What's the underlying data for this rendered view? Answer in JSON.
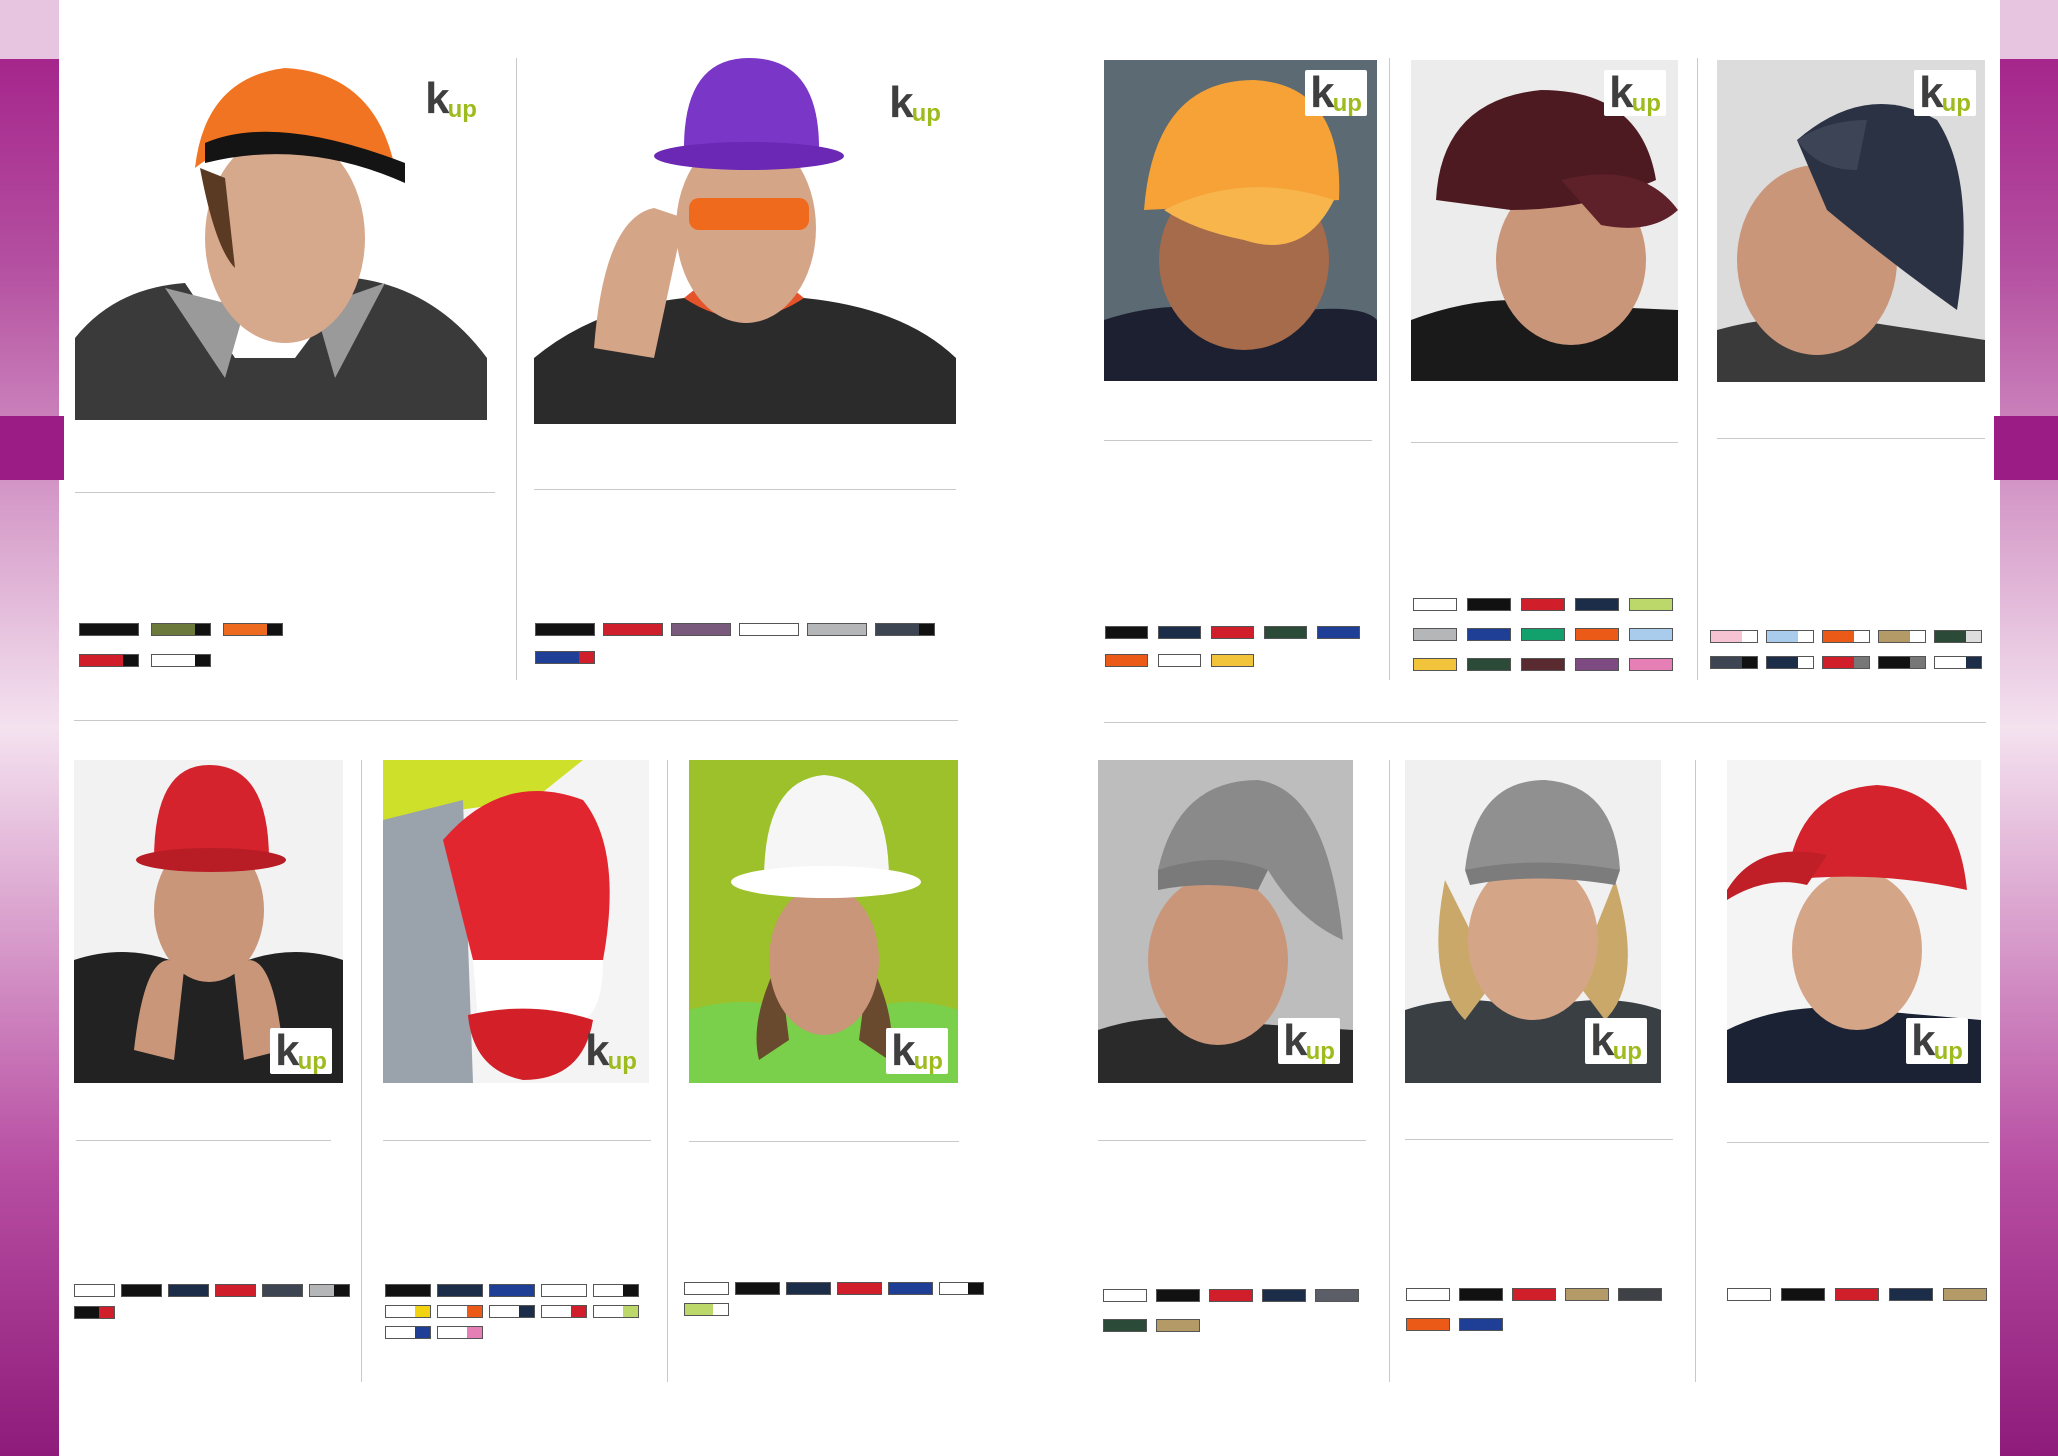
{
  "brand": {
    "logo_k": "k",
    "logo_up": "up",
    "logo_color": "#9dbb1c"
  },
  "theme": {
    "accent": "#a11a86",
    "rule": "#c9c9c9"
  },
  "products": [
    {
      "id": "p1",
      "logo": "plain",
      "swatches": [
        [
          "#111111"
        ],
        [
          "#6b7a3b",
          "#111111"
        ],
        [
          "#ee6a1e",
          "#111111"
        ],
        [
          "#d01e2a",
          "#111111"
        ],
        [
          "#ffffff",
          "#111111"
        ]
      ]
    },
    {
      "id": "p2",
      "logo": "plain",
      "swatches": [
        [
          "#111111"
        ],
        [
          "#cf1f2c"
        ],
        [
          "#7a5a7c"
        ],
        [
          "#ffffff"
        ],
        [
          "#b5b6b8"
        ],
        [
          "#3e4552",
          "#111111"
        ],
        [
          "#1f3f97",
          "#d01e2a"
        ]
      ]
    },
    {
      "id": "p3",
      "logo": "boxed",
      "swatches": [
        [
          "#111111"
        ],
        [
          "#1c2d4a"
        ],
        [
          "#d01e2a"
        ],
        [
          "#2c4a38"
        ],
        [
          "#1f3f97"
        ],
        [
          "#ec5a17"
        ],
        [
          "#ffffff"
        ],
        [
          "#f2c43b"
        ]
      ]
    },
    {
      "id": "p4",
      "logo": "boxed",
      "swatches": [
        [
          "#ffffff"
        ],
        [
          "#111111"
        ],
        [
          "#d01e2a"
        ],
        [
          "#1c2d4a"
        ],
        [
          "#bcd86a"
        ],
        [
          "#b5b6b8"
        ],
        [
          "#1f3f97"
        ],
        [
          "#12a06d"
        ],
        [
          "#ec5a17"
        ],
        [
          "#a9cbec"
        ],
        [
          "#f2c43b"
        ],
        [
          "#2c4a38"
        ],
        [
          "#5a2a31"
        ],
        [
          "#7d4a82"
        ],
        [
          "#e67fb6"
        ]
      ]
    },
    {
      "id": "p5",
      "logo": "boxed",
      "swatches": [
        [
          "#f6c3d3",
          "#ffffff"
        ],
        [
          "#a9cbec",
          "#ffffff"
        ],
        [
          "#ec5a17",
          "#ffffff"
        ],
        [
          "#b39a66",
          "#ffffff"
        ],
        [
          "#2c4a38",
          "#dddddd"
        ],
        [
          "#3e4552",
          "#111111"
        ],
        [
          "#1c2d4a",
          "#ffffff"
        ],
        [
          "#d01e2a",
          "#777777"
        ],
        [
          "#111111",
          "#777777"
        ],
        [
          "#ffffff",
          "#1c2d4a"
        ]
      ]
    },
    {
      "id": "p6",
      "logo": "boxed",
      "swatches": [
        [
          "#ffffff"
        ],
        [
          "#111111"
        ],
        [
          "#1c2d4a"
        ],
        [
          "#d01e2a"
        ],
        [
          "#3e4552"
        ],
        [
          "#b5b6b8",
          "#111111"
        ],
        [
          "#111111",
          "#d01e2a"
        ]
      ]
    },
    {
      "id": "p7",
      "logo": "plain",
      "swatches": [
        [
          "#111111"
        ],
        [
          "#1c2d4a"
        ],
        [
          "#1f3f97"
        ],
        [
          "#ffffff"
        ],
        [
          "#ffffff",
          "#111111"
        ],
        [
          "#ffffff",
          "#f2d30f"
        ],
        [
          "#ffffff",
          "#ec5a17"
        ],
        [
          "#ffffff",
          "#1c2d4a"
        ],
        [
          "#ffffff",
          "#d01e2a"
        ],
        [
          "#ffffff",
          "#bcd86a"
        ],
        [
          "#ffffff",
          "#1f3f97"
        ],
        [
          "#ffffff",
          "#e67fb6"
        ]
      ]
    },
    {
      "id": "p8",
      "logo": "boxed",
      "swatches": [
        [
          "#ffffff"
        ],
        [
          "#111111"
        ],
        [
          "#1c2d4a"
        ],
        [
          "#d01e2a"
        ],
        [
          "#1f3f97"
        ],
        [
          "#ffffff",
          "#111111"
        ],
        [
          "#bcd86a",
          "#ffffff"
        ]
      ]
    },
    {
      "id": "p9",
      "logo": "boxed",
      "swatches": [
        [
          "#ffffff"
        ],
        [
          "#111111"
        ],
        [
          "#d01e2a"
        ],
        [
          "#1c2d4a"
        ],
        [
          "#5b5e66"
        ],
        [
          "#2c4a38"
        ],
        [
          "#b39a66"
        ]
      ]
    },
    {
      "id": "p10",
      "logo": "boxed",
      "swatches": [
        [
          "#ffffff"
        ],
        [
          "#111111"
        ],
        [
          "#d01e2a"
        ],
        [
          "#b39a66"
        ],
        [
          "#3e4145"
        ],
        [
          "#ec5a17"
        ],
        [
          "#1f3f97"
        ]
      ]
    },
    {
      "id": "p11",
      "logo": "boxed",
      "swatches": [
        [
          "#ffffff"
        ],
        [
          "#111111"
        ],
        [
          "#d01e2a"
        ],
        [
          "#1c2d4a"
        ],
        [
          "#b39a66"
        ]
      ]
    }
  ]
}
